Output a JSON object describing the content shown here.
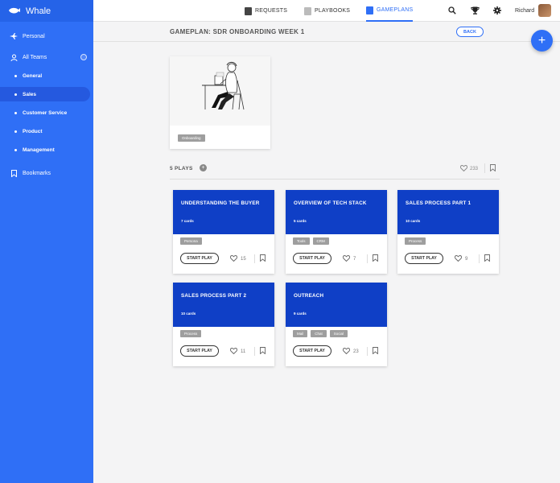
{
  "app": {
    "name": "Whale"
  },
  "sidebar": {
    "items": [
      {
        "label": "Personal",
        "icon": "plane-icon"
      },
      {
        "label": "All Teams",
        "icon": "team-icon"
      },
      {
        "label": "General"
      },
      {
        "label": "Sales",
        "active": true
      },
      {
        "label": "Customer Service"
      },
      {
        "label": "Product"
      },
      {
        "label": "Management"
      },
      {
        "label": "Bookmarks",
        "icon": "bookmark-icon"
      }
    ]
  },
  "topnav": {
    "tabs": [
      {
        "label": "REQUESTS"
      },
      {
        "label": "PLAYBOOKS"
      },
      {
        "label": "GAMEPLANS",
        "active": true
      }
    ],
    "user_name": "Richard"
  },
  "page": {
    "title": "GAMEPLAN: SDR ONBOARDING WEEK 1",
    "back_label": "BACK",
    "fab_label": "+"
  },
  "gameplan": {
    "tag": "Onboarding"
  },
  "plays_header": {
    "label": "5 PLAYS",
    "likes": "233",
    "add_label": "+"
  },
  "plays": [
    {
      "title": "UNDERSTANDING THE BUYER",
      "count": "7 cards",
      "tags": [
        "Persona"
      ],
      "likes": "15",
      "start_label": "START PLAY"
    },
    {
      "title": "OVERVIEW OF TECH STACK",
      "count": "5 cards",
      "tags": [
        "Tools",
        "CRM"
      ],
      "likes": "7",
      "start_label": "START PLAY"
    },
    {
      "title": "SALES PROCESS PART 1",
      "count": "10 cards",
      "tags": [
        "Process"
      ],
      "likes": "9",
      "start_label": "START PLAY"
    },
    {
      "title": "SALES PROCESS PART 2",
      "count": "10 cards",
      "tags": [
        "Process"
      ],
      "likes": "11",
      "start_label": "START PLAY"
    },
    {
      "title": "OUTREACH",
      "count": "9 cards",
      "tags": [
        "Mail",
        "Chat",
        "Social"
      ],
      "likes": "23",
      "start_label": "START PLAY"
    }
  ],
  "colors": {
    "primary": "#2f6ff6",
    "card_head": "#0f3fc6",
    "tag": "#9e9e9e"
  }
}
